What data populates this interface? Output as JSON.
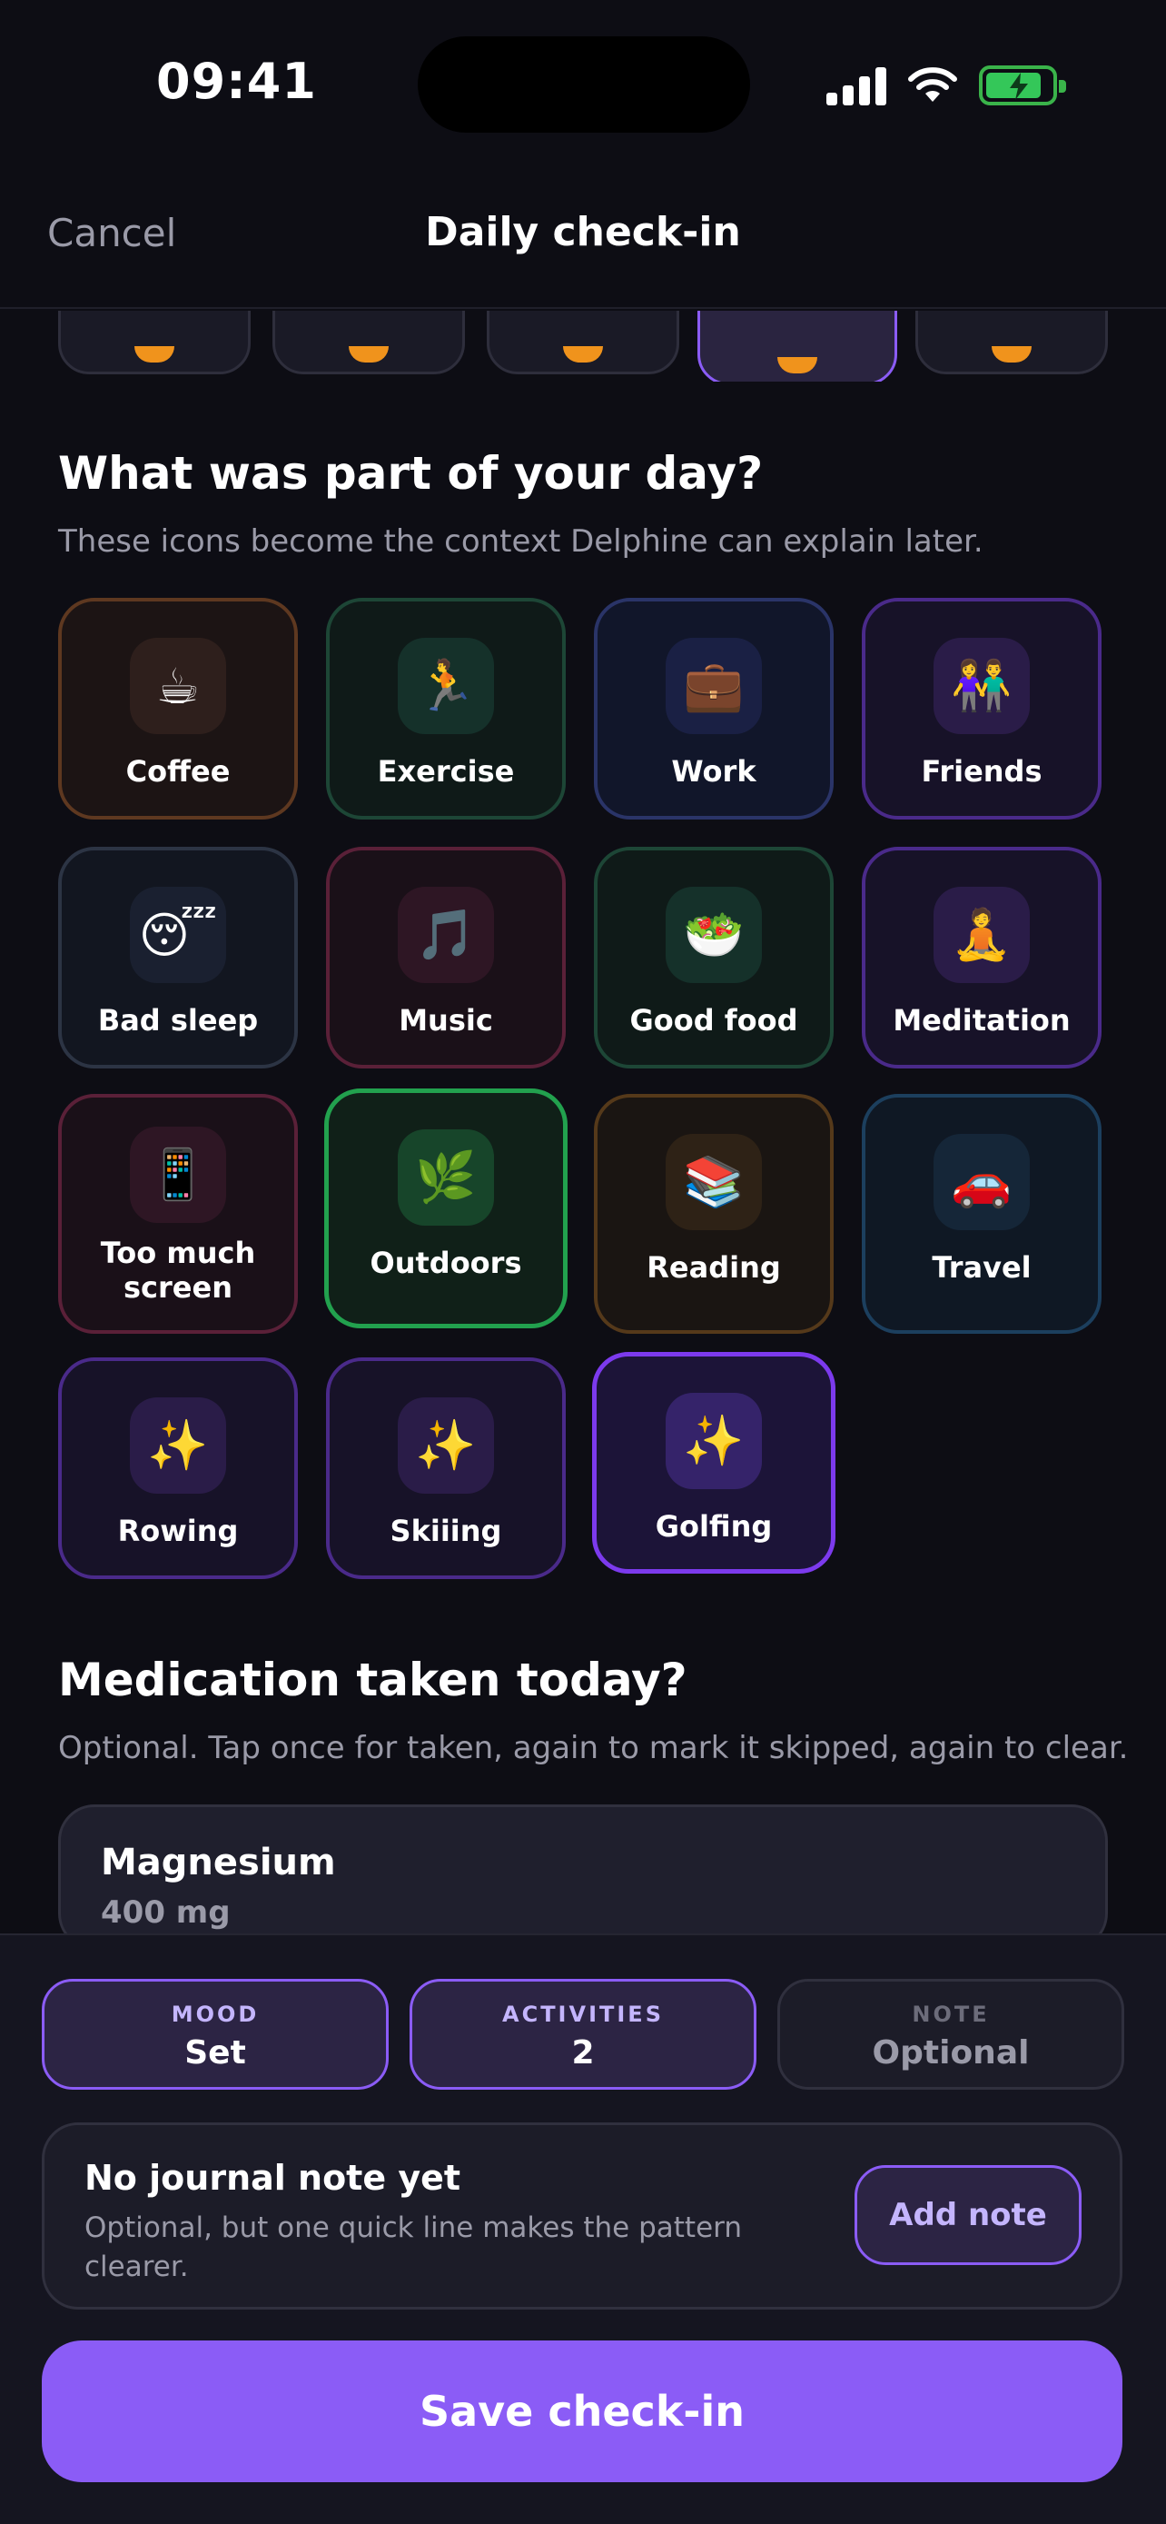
{
  "status_bar": {
    "time": "09:41"
  },
  "nav": {
    "cancel_label": "Cancel",
    "title": "Daily check-in"
  },
  "activities_section": {
    "title": "What was part of your day?",
    "subtitle": "These icons become the context Delphine can explain later.",
    "items": [
      {
        "label": "Coffee",
        "icon": "☕",
        "color": "orange",
        "selected": false
      },
      {
        "label": "Exercise",
        "icon": "🏃",
        "color": "green",
        "selected": false
      },
      {
        "label": "Work",
        "icon": "💼",
        "color": "blue",
        "selected": false
      },
      {
        "label": "Friends",
        "icon": "👫",
        "color": "purple",
        "selected": false
      },
      {
        "label": "Bad sleep",
        "icon": "😴",
        "color": "slate",
        "selected": false
      },
      {
        "label": "Music",
        "icon": "🎵",
        "color": "red",
        "selected": false
      },
      {
        "label": "Good food",
        "icon": "🥗",
        "color": "green",
        "selected": false
      },
      {
        "label": "Meditation",
        "icon": "🧘",
        "color": "purple",
        "selected": false
      },
      {
        "label": "Too much screen",
        "icon": "📱",
        "color": "red",
        "selected": false
      },
      {
        "label": "Outdoors",
        "icon": "🌿",
        "color": "green",
        "selected": true
      },
      {
        "label": "Reading",
        "icon": "📚",
        "color": "amber",
        "selected": false
      },
      {
        "label": "Travel",
        "icon": "🚗",
        "color": "teal",
        "selected": false
      },
      {
        "label": "Rowing",
        "icon": "✨",
        "color": "purple",
        "selected": false
      },
      {
        "label": "Skiiing",
        "icon": "✨",
        "color": "purple",
        "selected": false
      },
      {
        "label": "Golfing",
        "icon": "✨",
        "color": "purple",
        "selected": true
      }
    ]
  },
  "medication_section": {
    "title": "Medication taken today?",
    "subtitle": "Optional. Tap once for taken, again to mark it skipped, again to clear.",
    "items": [
      {
        "name": "Magnesium",
        "dose": "400 mg"
      }
    ]
  },
  "summary": {
    "chips": [
      {
        "key": "MOOD",
        "value": "Set",
        "state": "on"
      },
      {
        "key": "ACTIVITIES",
        "value": "2",
        "state": "on"
      },
      {
        "key": "NOTE",
        "value": "Optional",
        "state": "off"
      }
    ]
  },
  "journal": {
    "title": "No journal note yet",
    "subtitle": "Optional, but one quick line makes the pattern clearer.",
    "add_label": "Add note"
  },
  "save_label": "Save check-in",
  "colors": {
    "accent": "#8b5cf6",
    "selected_green": "#22a14e",
    "background": "#0d0d14"
  }
}
